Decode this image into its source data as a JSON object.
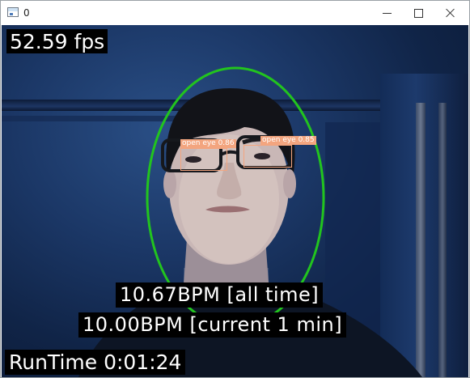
{
  "window": {
    "title": "0",
    "icons": {
      "app": "window-icon",
      "minimize": "minimize-icon",
      "maximize": "maximize-icon",
      "close": "close-icon"
    }
  },
  "overlay": {
    "fps": "52.59 fps",
    "bpm_all_time": "10.67BPM [all time]",
    "bpm_current": "10.00BPM [current 1 min]",
    "runtime": "RunTime 0:01:24"
  },
  "detections": [
    {
      "label": "open eye 0.86"
    },
    {
      "label": "open eye 0.85"
    }
  ],
  "colors": {
    "face_ellipse": "#22c41e",
    "detection_box": "#f3a57f",
    "label_background": "#000000",
    "label_text": "#ffffff"
  }
}
